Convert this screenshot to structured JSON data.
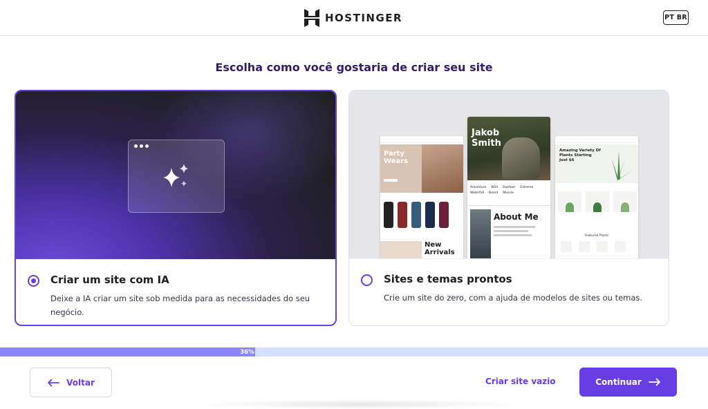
{
  "header": {
    "brand": "HOSTINGER",
    "language": "PT BR"
  },
  "page_title": "Escolha como você gostaria de criar seu site",
  "options": [
    {
      "title": "Criar um site com IA",
      "description": "Deixe a IA criar um site sob medida para as necessidades do seu negócio.",
      "selected": true
    },
    {
      "title": "Sites e temas prontos",
      "description": "Crie um site do zero, com a ajuda de modelos de sites ou temas.",
      "selected": false
    }
  ],
  "template_previews": {
    "left": {
      "headline": "Party Wears",
      "sub": "New Arrivals"
    },
    "center": {
      "headline": "Jakob Smith",
      "about": "About Me",
      "menu": [
        "Adventure",
        "Wild",
        "Outdoor",
        "Extreme",
        "Waterfall",
        "Beard",
        "Muscle"
      ]
    },
    "right": {
      "headline": "Amazing Variety Of Plants Starting Just $6",
      "section": "Featured Plants"
    }
  },
  "progress": {
    "percent": 36,
    "label": "36%"
  },
  "footer": {
    "back_label": "Voltar",
    "empty_label": "Criar site vazio",
    "continue_label": "Continuar"
  },
  "colors": {
    "accent": "#673de6",
    "progress_fill": "#8c85ff",
    "progress_track": "#d5dfff",
    "title": "#2f1c6a"
  },
  "icons": {
    "logo": "hostinger-logo-icon",
    "back": "arrow-left-icon",
    "next": "arrow-right-icon",
    "ai": "sparkles-icon"
  }
}
